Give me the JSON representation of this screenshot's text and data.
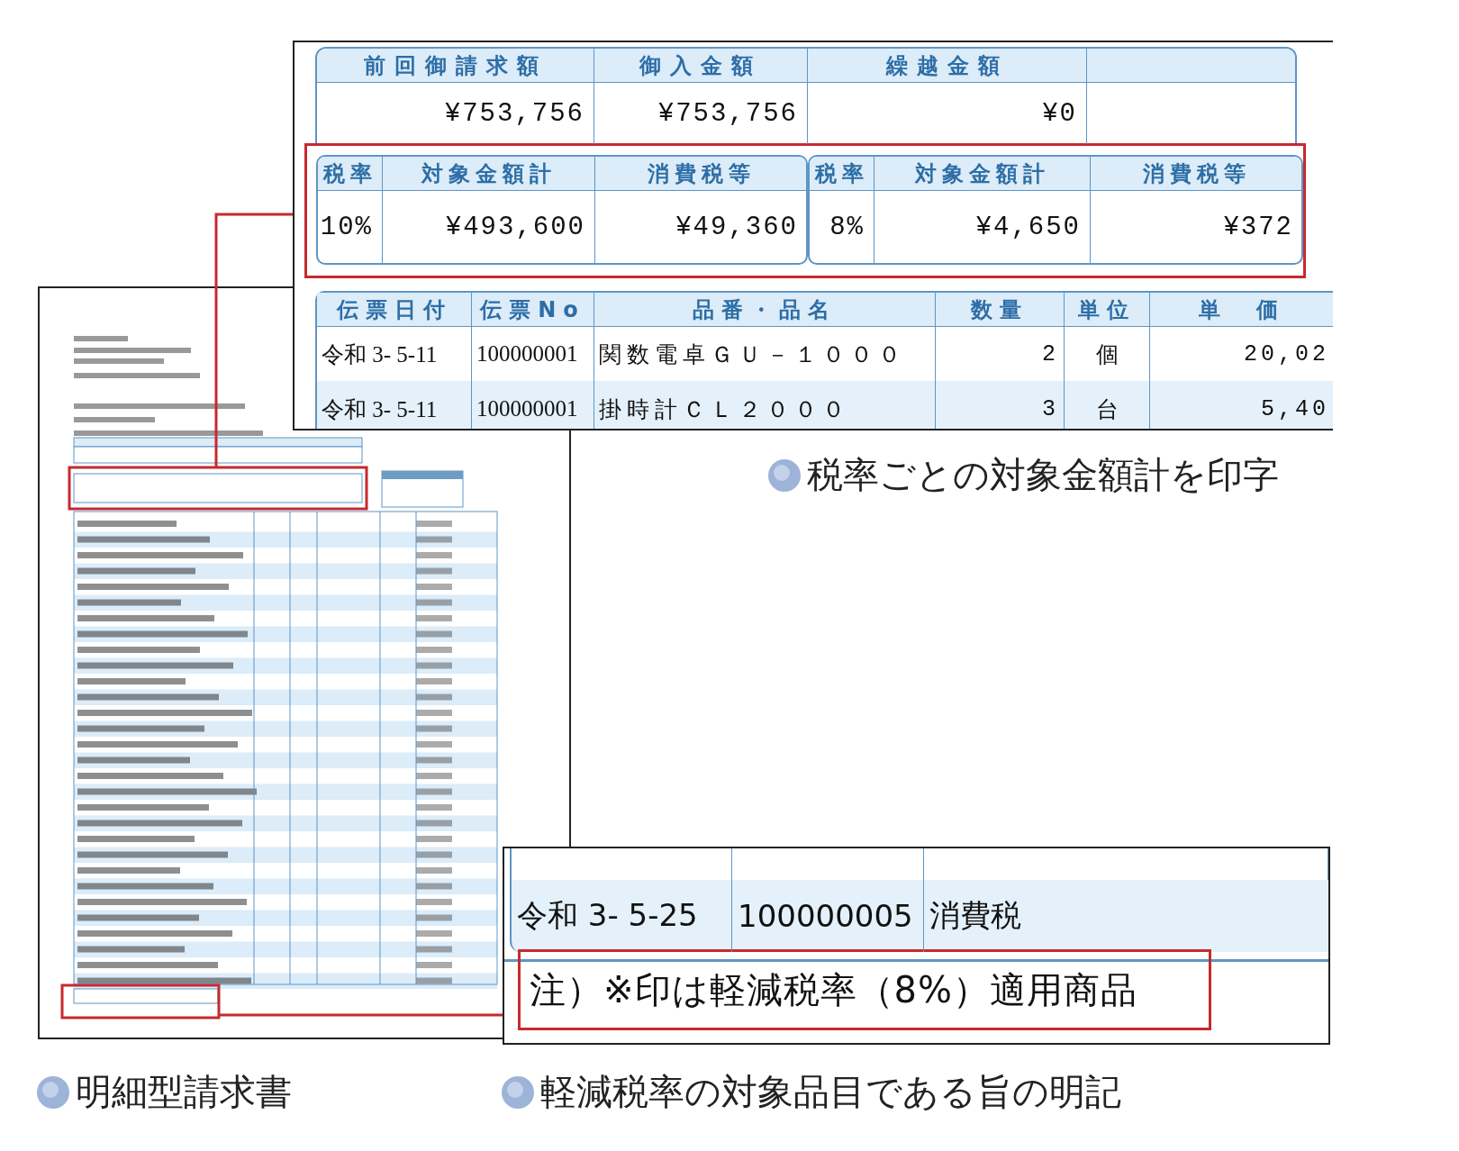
{
  "summary_panel": {
    "balance_headers": [
      "前回御請求額",
      "御入金額",
      "繰越金額"
    ],
    "balance_values": [
      "¥753,756",
      "¥753,756",
      "¥0"
    ],
    "tax_groups": [
      {
        "rate_header": "税率",
        "base_header": "対象金額計",
        "tax_header": "消費税等",
        "rate": "10%",
        "base": "¥493,600",
        "tax": "¥49,360"
      },
      {
        "rate_header": "税率",
        "base_header": "対象金額計",
        "tax_header": "消費税等",
        "rate": "8%",
        "base": "¥4,650",
        "tax": "¥372"
      }
    ],
    "item_table": {
      "columns": [
        "伝票日付",
        "伝票No",
        "品番・品名",
        "数量",
        "単位",
        "単　価"
      ],
      "rows": [
        [
          "令和 3- 5-11",
          "100000001",
          "関数電卓ＧＵ－１０００",
          "2",
          "個",
          "20,02"
        ],
        [
          "令和 3- 5-11",
          "100000001",
          "掛時計ＣＬ２０００",
          "3",
          "台",
          "5,40"
        ]
      ]
    }
  },
  "summary_caption": "税率ごとの対象金額計を印字",
  "note_panel": {
    "row": [
      "令和 3- 5-25",
      "100000005",
      "消費税"
    ],
    "note": "注）※印は軽減税率（8%）適用商品"
  },
  "captions": [
    "明細型請求書",
    "軽減税率の対象品目である旨の明記"
  ]
}
